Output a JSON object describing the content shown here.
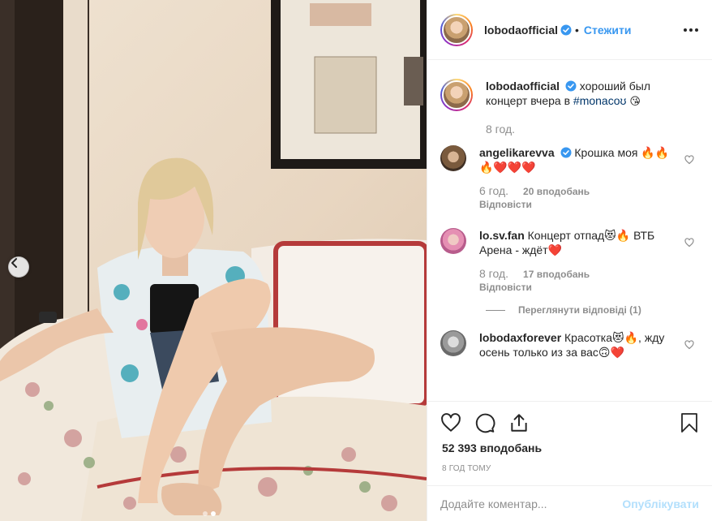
{
  "header": {
    "username": "lobodaofficial",
    "separator": "•",
    "follow_label": "Стежити",
    "more_icon": "more-horizontal-icon"
  },
  "caption": {
    "username": "lobodaofficial",
    "text_before": "хороший был концерт вчера в ",
    "hashtag": "#monacoʊ",
    "emoji": "😘",
    "time": "8 год."
  },
  "comments": [
    {
      "username": "angelikarevva",
      "verified": true,
      "text": "Крошка моя 🔥🔥🔥❤️❤️❤️",
      "time": "6 год.",
      "likes": "20 вподобань",
      "reply_label": "Відповісти"
    },
    {
      "username": "lo.sv.fan",
      "verified": false,
      "text": "Концерт отпад😻🔥 ВТБ Арена - ждёт❤️",
      "time": "8 год.",
      "likes": "17 вподобань",
      "reply_label": "Відповісти",
      "view_replies": "Переглянути відповіді (1)"
    },
    {
      "username": "lobodaxforever",
      "verified": false,
      "text": "Красотка😻🔥, жду осень только из за вас🙃❤️"
    }
  ],
  "actions": {
    "like_icon": "heart-icon",
    "comment_icon": "comment-icon",
    "share_icon": "share-icon",
    "save_icon": "bookmark-icon"
  },
  "likes_total": "52 393 вподобань",
  "timestamp": "8 ГОД ТОМУ",
  "composer": {
    "placeholder": "Додайте коментар...",
    "post_label": "Опублікувати"
  },
  "carousel": {
    "current_index": 2,
    "total": 2
  },
  "colors": {
    "accent": "#3897f0",
    "text": "#262626",
    "muted": "#8e8e8e",
    "border": "#efefef",
    "verified": "#3897f0",
    "post_disabled": "#b2dffc"
  }
}
